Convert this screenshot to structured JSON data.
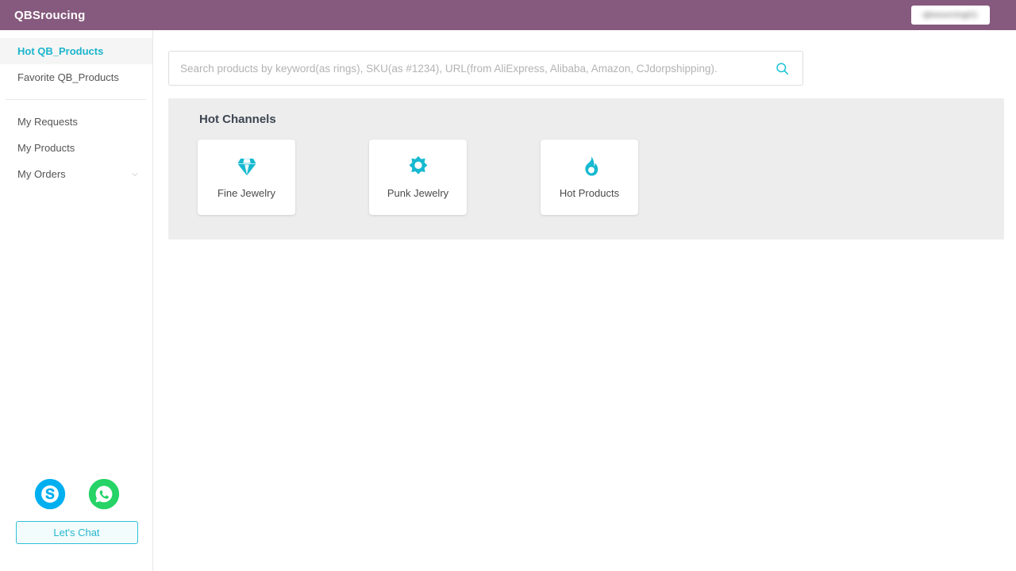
{
  "header": {
    "brand": "QBSroucing",
    "account_label_redacted": "qbsourcing01"
  },
  "sidebar": {
    "items": [
      {
        "label": "Hot QB_Products",
        "active": true,
        "icon": "none"
      },
      {
        "label": "Favorite QB_Products",
        "active": false,
        "icon": "none"
      }
    ],
    "items_secondary": [
      {
        "label": "My Requests",
        "icon": "none"
      },
      {
        "label": "My Products",
        "icon": "none"
      },
      {
        "label": "My Orders",
        "icon": "chevron-down-icon"
      }
    ],
    "chat": {
      "skype_icon": "skype-icon",
      "whatsapp_icon": "whatsapp-icon",
      "button_label": "Let's Chat"
    }
  },
  "search": {
    "value": "",
    "placeholder": "Search products by keyword(as rings), SKU(as #1234), URL(from AliExpress, Alibaba, Amazon, CJdorpshipping).",
    "icon": "search-icon"
  },
  "main": {
    "panel_title": "Hot Channels",
    "channels": [
      {
        "label": "Fine Jewelry",
        "icon": "diamond-icon"
      },
      {
        "label": "Punk Jewelry",
        "icon": "sunburst-icon"
      },
      {
        "label": "Hot Products",
        "icon": "flame-icon"
      }
    ]
  },
  "colors": {
    "header_purple": "#865a7e",
    "accent_cyan": "#1ab5cc",
    "panel_gray": "#ededed",
    "skype_blue": "#00aff0",
    "whatsapp_green": "#25d366"
  }
}
